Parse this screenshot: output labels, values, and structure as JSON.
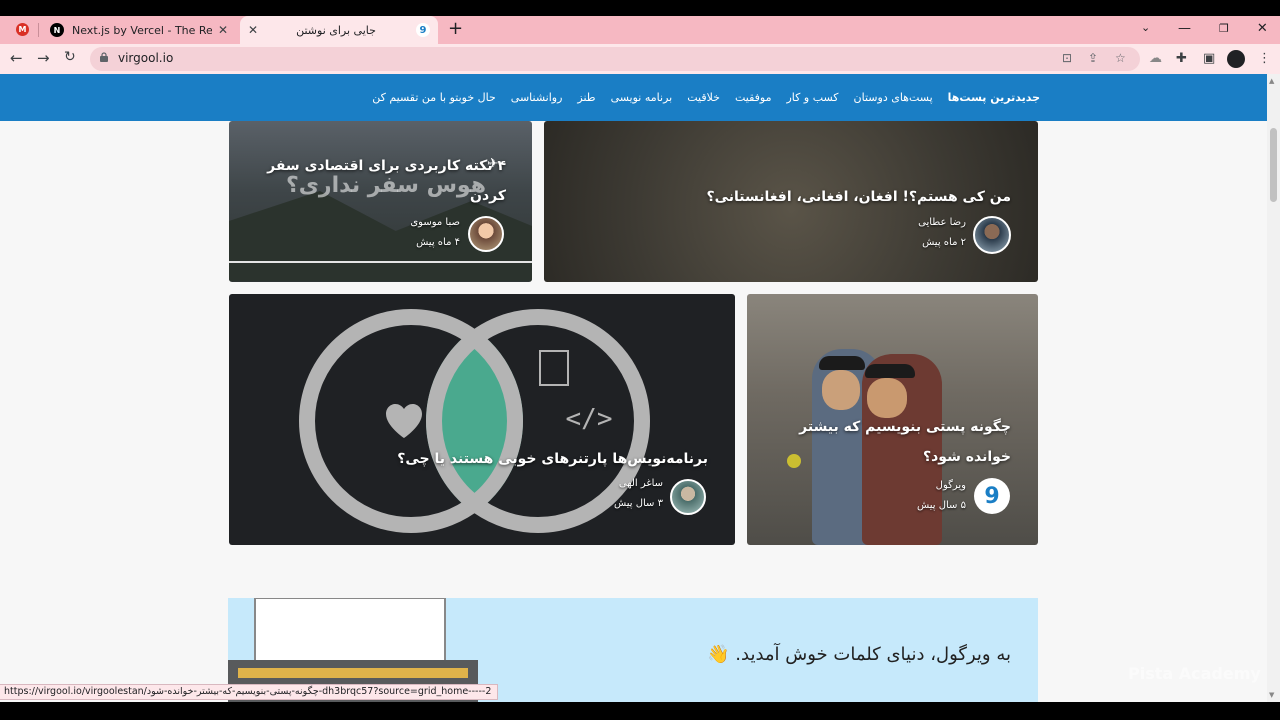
{
  "browser": {
    "tabs": [
      {
        "title": "Next.js by Vercel - The React Fram",
        "icon": "nextjs-icon",
        "active": false
      },
      {
        "title": "جایی برای نوشتن",
        "icon": "virgool-icon",
        "active": true
      }
    ],
    "address": "virgool.io",
    "colors": {
      "tabstrip": "#f6b8c2",
      "toolbar": "#fde7ea"
    }
  },
  "site": {
    "nav": [
      "جدیدترین پست‌ها",
      "پست‌های دوستان",
      "کسب و کار",
      "موفقیت",
      "خلاقیت",
      "برنامه نویسی",
      "طنز",
      "روانشناسی",
      "حال خوبتو با من تقسیم کن"
    ],
    "brand_color": "#1a7ec5"
  },
  "posts": [
    {
      "title": "۴ نکته کاربردی برای اقتصادی سفر کردن",
      "image_text": "هوس سفر نداری؟",
      "author": "صبا موسوی",
      "time": "۴ ماه پیش"
    },
    {
      "title": "من کی هستم؟! افغان، افغانی، افغانستانی؟",
      "author": "رضا عطایی",
      "time": "۲ ماه پیش"
    },
    {
      "title": "برنامه‌نویس‌ها پارتنرهای خوبی هستند یا چی؟",
      "author": "ساغر الهی",
      "time": "۳ سال پیش"
    },
    {
      "title": "چگونه پستی بنویسیم که بیشتر خوانده شود؟",
      "author": "ویرگول",
      "time": "۵ سال پیش"
    }
  ],
  "welcome": {
    "text": "به ویرگول، دنیای کلمات خوش آمدید. 👋"
  },
  "status_url": "https://virgool.io/virgoolestan/چگونه-پستی-بنویسیم-که-بیشتر-خوانده-شود-dh3brqc57?source=grid_home-----2",
  "watermark": "Pista Academy"
}
